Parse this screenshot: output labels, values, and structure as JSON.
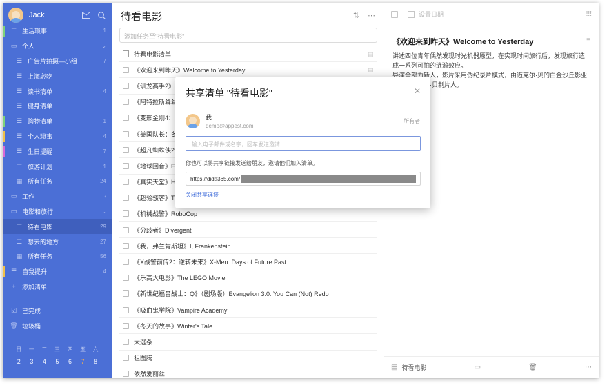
{
  "colors": {
    "sidebar_bg": "#4b6fd6",
    "accent": "#4a74dc"
  },
  "user": {
    "name": "Jack"
  },
  "sidebar": {
    "items": [
      {
        "label": "生活琐事",
        "count": "1",
        "icon": "list-icon",
        "bar": "#7ed27b",
        "level": 0
      },
      {
        "label": "个人",
        "count": "",
        "icon": "folder-icon",
        "bar": "",
        "level": 0,
        "chevron": "⌄"
      },
      {
        "label": "广告片拍摄—小组...",
        "count": "7",
        "icon": "list-icon",
        "bar": "",
        "level": 1
      },
      {
        "label": "上海必吃",
        "count": "",
        "icon": "list-icon",
        "bar": "",
        "level": 1
      },
      {
        "label": "读书清单",
        "count": "4",
        "icon": "list-icon",
        "bar": "",
        "level": 1
      },
      {
        "label": "健身清单",
        "count": "",
        "icon": "list-icon",
        "bar": "",
        "level": 1
      },
      {
        "label": "购物清单",
        "count": "1",
        "icon": "list-icon",
        "bar": "#7ed27b",
        "level": 1
      },
      {
        "label": "个人琐事",
        "count": "4",
        "icon": "list-icon",
        "bar": "#f0c14b",
        "level": 1
      },
      {
        "label": "生日提醒",
        "count": "7",
        "icon": "list-icon",
        "bar": "#d86ad8",
        "level": 1
      },
      {
        "label": "旅游计划",
        "count": "1",
        "icon": "list-icon",
        "bar": "",
        "level": 1
      },
      {
        "label": "所有任务",
        "count": "24",
        "icon": "calendar-icon",
        "bar": "",
        "level": 1
      },
      {
        "label": "工作",
        "count": "",
        "icon": "folder-icon",
        "bar": "",
        "level": 0,
        "chevron": "‹"
      },
      {
        "label": "电影和旅行",
        "count": "",
        "icon": "folder-icon",
        "bar": "",
        "level": 0,
        "chevron": "⌄"
      },
      {
        "label": "待看电影",
        "count": "29",
        "icon": "list-icon",
        "bar": "",
        "level": 1,
        "active": true
      },
      {
        "label": "想去的地方",
        "count": "27",
        "icon": "list-icon",
        "bar": "",
        "level": 1
      },
      {
        "label": "所有任务",
        "count": "56",
        "icon": "calendar-icon",
        "bar": "",
        "level": 1
      },
      {
        "label": "自我提升",
        "count": "4",
        "icon": "list-icon",
        "bar": "#f0c14b",
        "level": 0
      },
      {
        "label": "添加清单",
        "count": "",
        "icon": "plus-icon",
        "bar": "",
        "level": 0
      }
    ],
    "bottom": [
      {
        "label": "已完成",
        "icon": "check-icon"
      },
      {
        "label": "垃圾桶",
        "icon": "trash-icon"
      }
    ],
    "calendar": {
      "weekdays": [
        "日",
        "一",
        "二",
        "三",
        "四",
        "五",
        "六"
      ],
      "days": [
        "2",
        "3",
        "4",
        "5",
        "6",
        "7",
        "8"
      ],
      "today_index": 5
    }
  },
  "middle": {
    "title": "待看电影",
    "add_placeholder": "添加任务至\"待看电影\"",
    "header_item": "待看电影清单",
    "tasks": [
      {
        "text": "《欢迎来到昨天》Welcome to Yesterday",
        "note": true
      },
      {
        "text": "《训龙高手2》H",
        "note": false
      },
      {
        "text": "《阿特拉斯耸耸",
        "note": false
      },
      {
        "text": "《变形金刚4：绝",
        "note": false
      },
      {
        "text": "《美国队长：冬",
        "note": false
      },
      {
        "text": "《超凡蜘蛛侠2》",
        "note": false
      },
      {
        "text": "《地球回音》Ea",
        "note": false
      },
      {
        "text": "《真实天堂》He",
        "note": false
      },
      {
        "text": "《超验骇客》Tra",
        "note": false
      },
      {
        "text": "《机械战警》RoboCop",
        "note": false
      },
      {
        "text": "《分歧者》Divergent",
        "note": false
      },
      {
        "text": "《我，弗兰肯斯坦》I, Frankenstein",
        "note": false
      },
      {
        "text": "《X战警前传2：逆转未来》X-Men: Days of Future Past",
        "note": false
      },
      {
        "text": "《乐高大电影》The LEGO Movie",
        "note": false
      },
      {
        "text": "《新世纪福音战士：Q》（剧场版）Evangelion 3.0: You Can (Not) Redo",
        "note": false
      },
      {
        "text": "《吸血鬼学院》Vampire Academy",
        "note": false
      },
      {
        "text": "《冬天的故事》Winter's Tale",
        "note": false
      },
      {
        "text": "大逃杀",
        "note": false
      },
      {
        "text": "狙图腾",
        "note": false
      },
      {
        "text": "依然爱丽丝",
        "note": false
      }
    ]
  },
  "detail": {
    "date_label": "设置日期",
    "title": "《欢迎来到昨天》Welcome to Yesterday",
    "body": "讲述四位青年偶然发现时光机器原型，在实现时间旅行后，发现旅行造成一系列可怕的涟漪效应。\n导演全部为新人，影片采用伪纪录片模式，由迈克尔·贝的白金沙丘影业制片，迈克尔·贝制片人。",
    "footer_list": "待看电影"
  },
  "dialog": {
    "title": "共享清单 \"待看电影\"",
    "owner_name": "我",
    "owner_email": "demo@appest.com",
    "owner_role": "所有者",
    "invite_placeholder": "输入电子邮件或名字，回车发送邀请",
    "tip": "你也可以将共享链接发送给朋友，邀请他们加入清单。",
    "link_prefix": "https://dida365.com/",
    "close_link": "关闭共享连接"
  }
}
